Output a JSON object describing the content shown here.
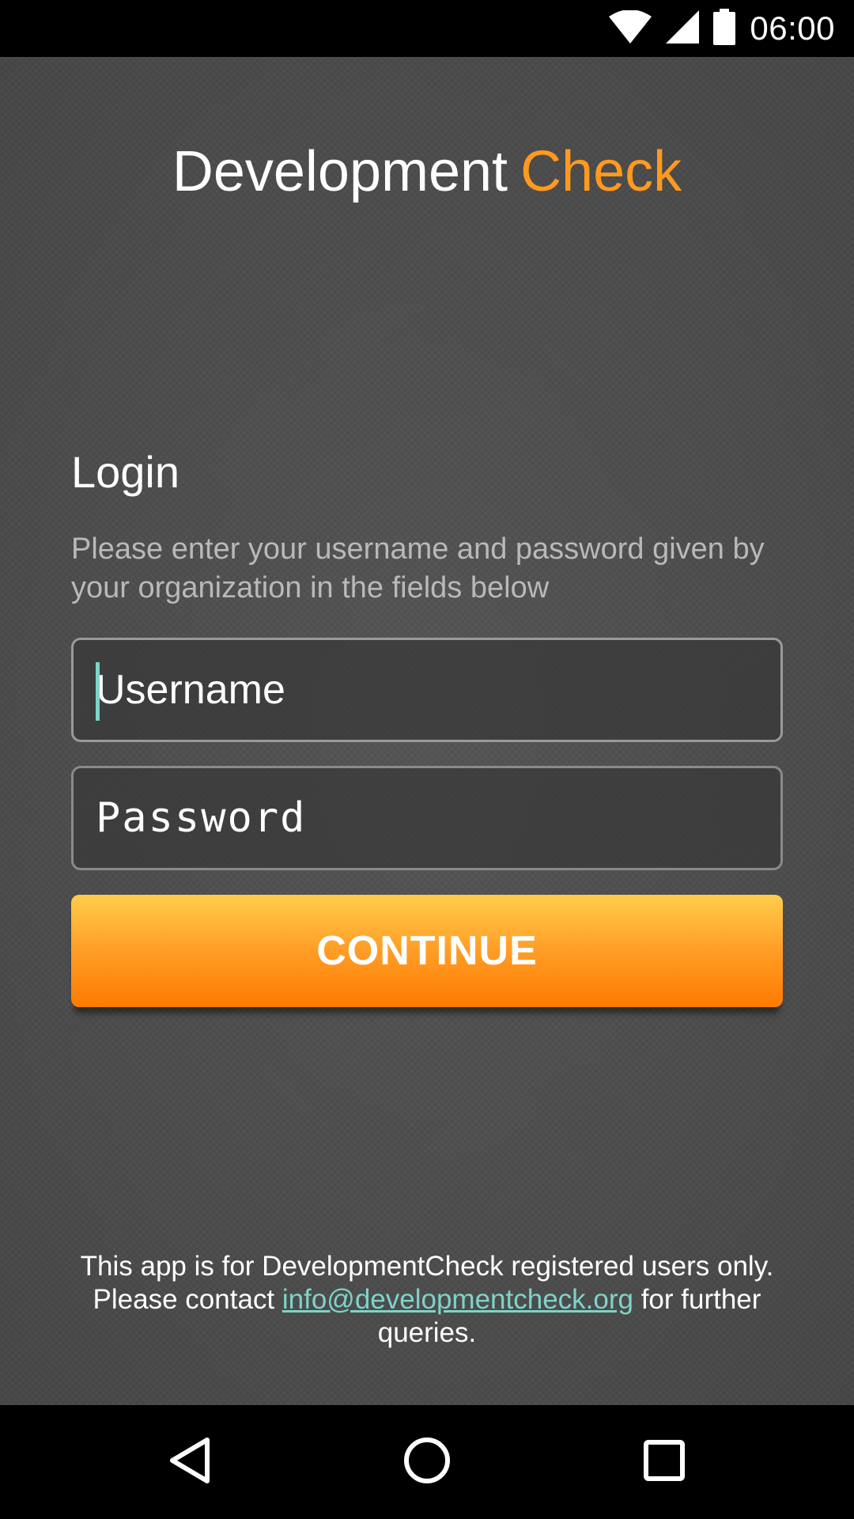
{
  "status_bar": {
    "time": "06:00",
    "icons": [
      "wifi-icon",
      "cell-signal-icon",
      "battery-icon"
    ]
  },
  "app": {
    "title_word_1": "Development",
    "title_word_2": "Check",
    "accent_color": "#ff9a1f",
    "link_color": "#7fd3c8"
  },
  "login": {
    "heading": "Login",
    "description": "Please enter your username and password given by your organization in the fields below",
    "username_placeholder": "Username",
    "username_value": "",
    "password_placeholder": "Password",
    "password_value": "",
    "continue_label": "CONTINUE"
  },
  "footer": {
    "text_before": "This app is for DevelopmentCheck registered users only. Please contact ",
    "email": "info@developmentcheck.org",
    "text_after": " for further queries."
  },
  "nav_bar": {
    "icons": [
      "back-icon",
      "home-icon",
      "recents-icon"
    ]
  }
}
